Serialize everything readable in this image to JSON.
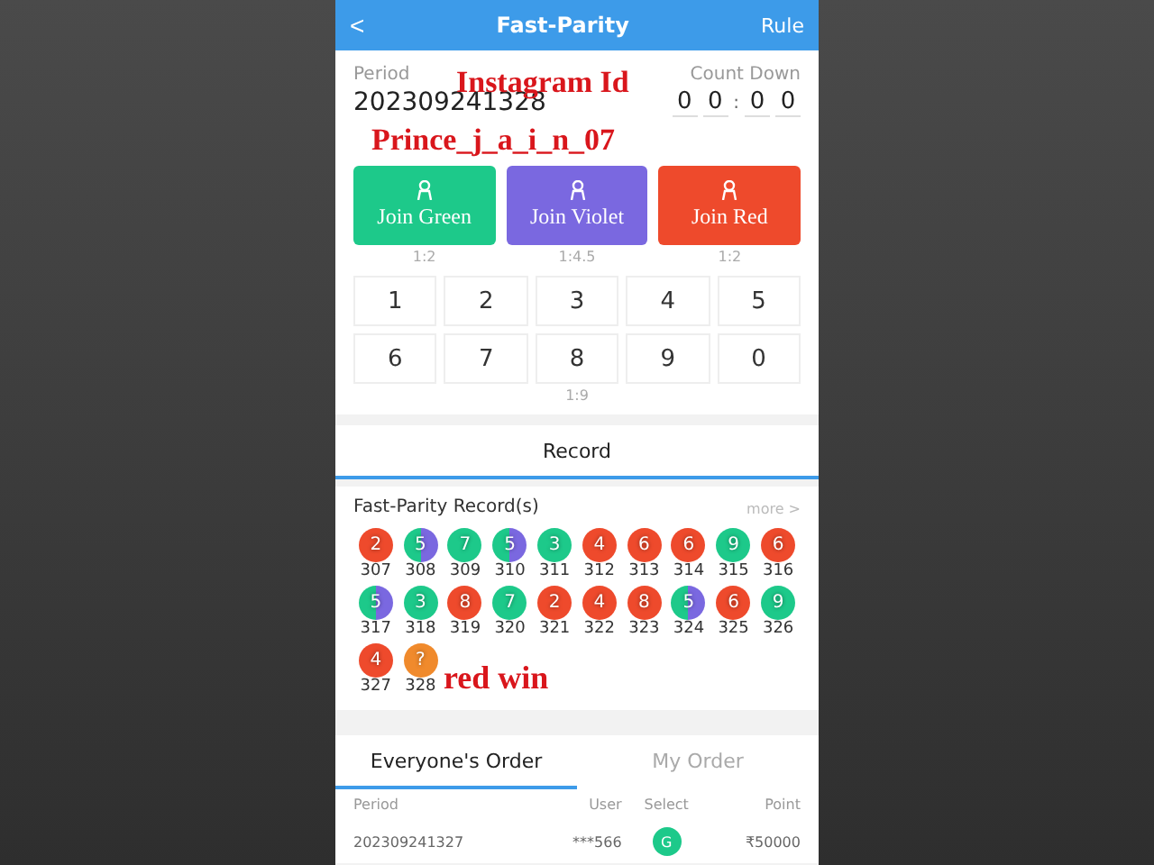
{
  "header": {
    "back": "<",
    "title": "Fast-Parity",
    "action": "Rule"
  },
  "period": {
    "label": "Period",
    "value": "202309241328",
    "countdown_label": "Count Down",
    "digits": [
      "0",
      "0",
      "0",
      "0"
    ],
    "separator": ":"
  },
  "join_buttons": [
    {
      "label": "Join Green",
      "ratio": "1:2",
      "color": "#1dc98a"
    },
    {
      "label": "Join Violet",
      "ratio": "1:4.5",
      "color": "#7a68e0"
    },
    {
      "label": "Join Red",
      "ratio": "1:2",
      "color": "#ee4a2c"
    }
  ],
  "numbers": [
    "1",
    "2",
    "3",
    "4",
    "5",
    "6",
    "7",
    "8",
    "9",
    "0"
  ],
  "numbers_ratio": "1:9",
  "record_tab": {
    "label": "Record",
    "selected": true
  },
  "records": {
    "title": "Fast-Parity Record(s)",
    "more": "more >",
    "items": [
      {
        "number": "2",
        "period": "307",
        "kind": "red"
      },
      {
        "number": "5",
        "period": "308",
        "kind": "green-violet"
      },
      {
        "number": "7",
        "period": "309",
        "kind": "green"
      },
      {
        "number": "5",
        "period": "310",
        "kind": "green-violet"
      },
      {
        "number": "3",
        "period": "311",
        "kind": "green"
      },
      {
        "number": "4",
        "period": "312",
        "kind": "red"
      },
      {
        "number": "6",
        "period": "313",
        "kind": "red"
      },
      {
        "number": "6",
        "period": "314",
        "kind": "red"
      },
      {
        "number": "9",
        "period": "315",
        "kind": "green"
      },
      {
        "number": "6",
        "period": "316",
        "kind": "red"
      },
      {
        "number": "5",
        "period": "317",
        "kind": "green-violet"
      },
      {
        "number": "3",
        "period": "318",
        "kind": "green"
      },
      {
        "number": "8",
        "period": "319",
        "kind": "red"
      },
      {
        "number": "7",
        "period": "320",
        "kind": "green"
      },
      {
        "number": "2",
        "period": "321",
        "kind": "red"
      },
      {
        "number": "4",
        "period": "322",
        "kind": "red"
      },
      {
        "number": "8",
        "period": "323",
        "kind": "red"
      },
      {
        "number": "5",
        "period": "324",
        "kind": "green-violet"
      },
      {
        "number": "6",
        "period": "325",
        "kind": "red"
      },
      {
        "number": "9",
        "period": "326",
        "kind": "green"
      },
      {
        "number": "4",
        "period": "327",
        "kind": "red"
      },
      {
        "number": "?",
        "period": "328",
        "kind": "pending"
      }
    ]
  },
  "order_tabs": [
    {
      "label": "Everyone's Order",
      "selected": true
    },
    {
      "label": "My Order",
      "selected": false
    }
  ],
  "order_table": {
    "columns": [
      "Period",
      "User",
      "Select",
      "Point"
    ],
    "rows": [
      {
        "period": "202309241327",
        "user": "***566",
        "select": "G",
        "color": "#1dc98a",
        "point": "₹50000"
      }
    ]
  },
  "overlay": {
    "line_1": "Instagram Id",
    "line_2": "Prince_j_a_i_n_07",
    "line_3": "red win"
  }
}
